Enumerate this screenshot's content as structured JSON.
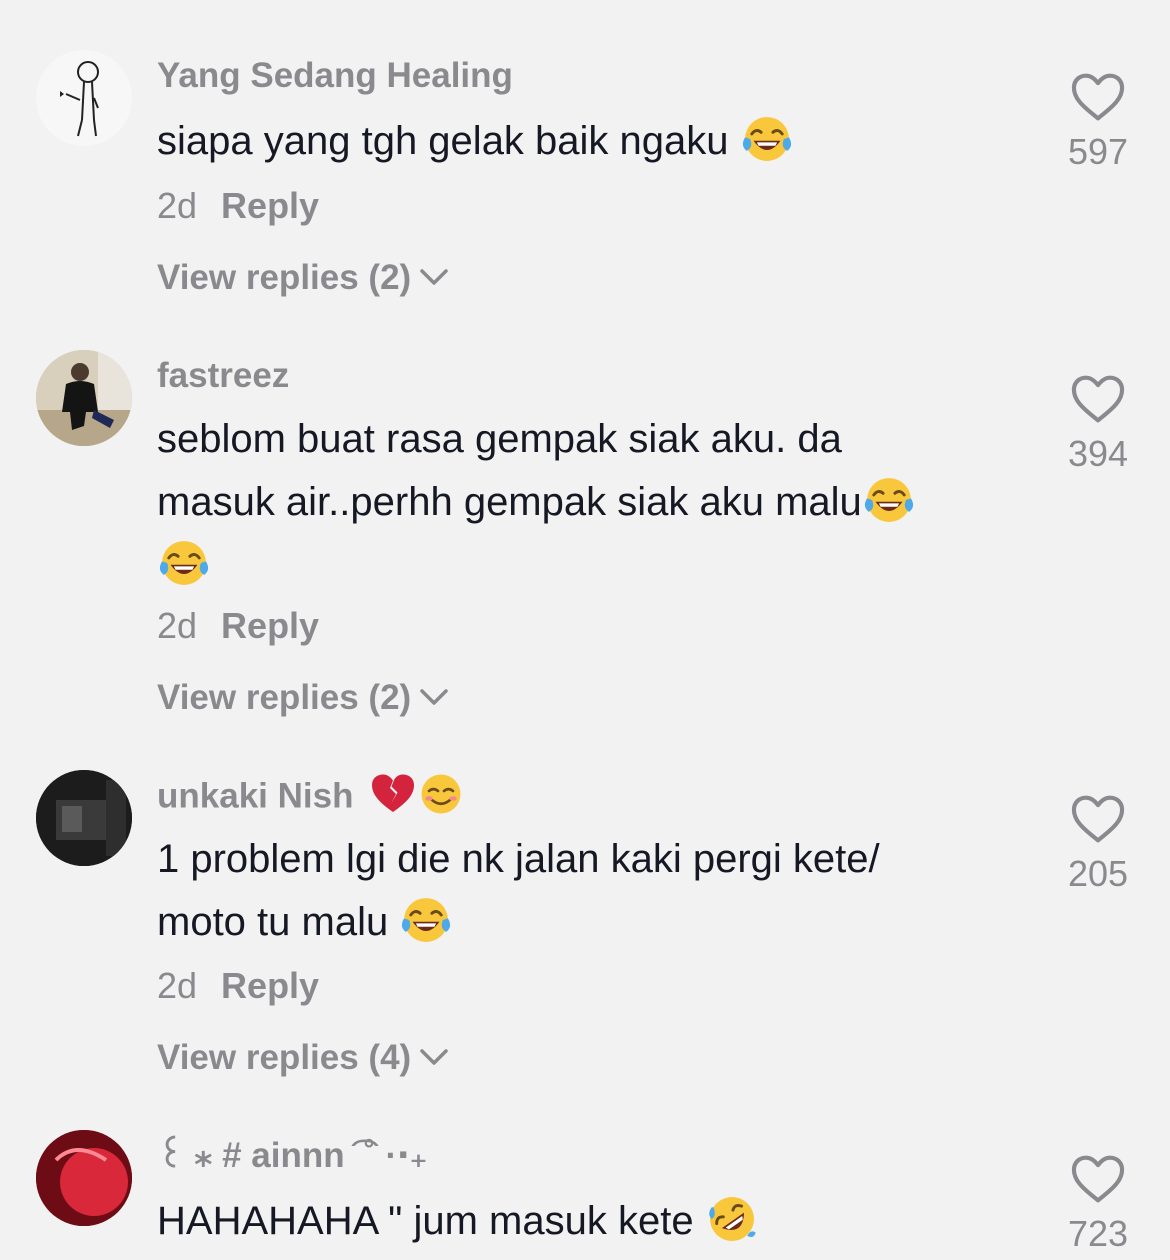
{
  "comments": [
    {
      "username": "Yang Sedang Healing",
      "text_lines": [
        "siapa yang tgh gelak baik ngaku "
      ],
      "age": "2d",
      "reply_label": "Reply",
      "view_replies": "View replies (2)",
      "likes": "597",
      "avatar_icon": "stick-figure-drawing"
    },
    {
      "username": "fastreez",
      "text_lines": [
        "seblom buat rasa gempak siak aku. da",
        "masuk air..perhh gempak siak aku malu",
        ""
      ],
      "age": "2d",
      "reply_label": "Reply",
      "view_replies": "View replies (2)",
      "likes": "394",
      "avatar_icon": "person-photo"
    },
    {
      "username": "unkaki Nish",
      "text_lines": [
        "1 problem lgi die nk jalan kaki pergi kete/",
        "moto tu malu "
      ],
      "age": "2d",
      "reply_label": "Reply",
      "view_replies": "View replies (4)",
      "likes": "205",
      "avatar_icon": "dark-photo"
    },
    {
      "username": "꒰ ⁎ # ainnn  ͡ ˚ ·‧₊",
      "text_lines": [
        "HAHAHAHA \" jum masuk kete "
      ],
      "likes": "723",
      "avatar_icon": "red-photo"
    }
  ],
  "icons": {
    "heart": "heart-outline-icon",
    "chevron": "chevron-down-icon",
    "laughing": "face-with-tears-of-joy-emoji",
    "rofl": "rolling-on-floor-laughing-emoji",
    "broken_heart": "broken-heart-emoji",
    "smiling": "smiling-face-emoji"
  },
  "colors": {
    "background": "#f2f2f3",
    "text": "#161823",
    "muted": "#8a8a8e"
  }
}
